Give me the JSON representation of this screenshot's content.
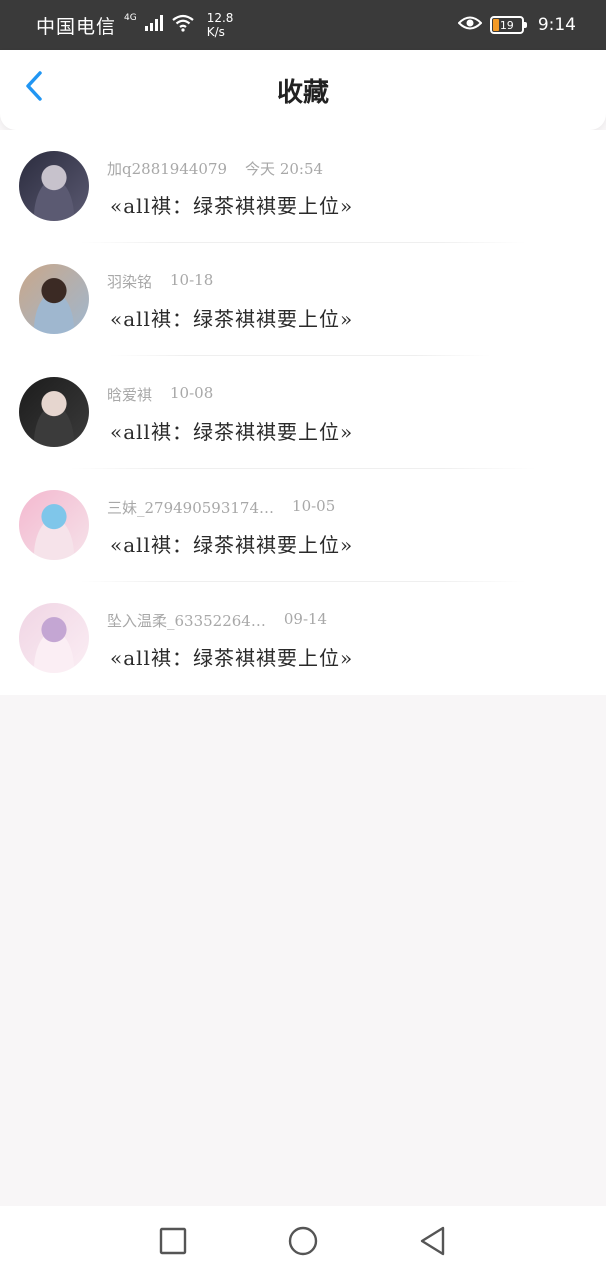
{
  "status_bar": {
    "carrier": "中国电信",
    "network": "4G",
    "speed_value": "12.8",
    "speed_unit": "K/s",
    "battery": "19",
    "time": "9:14"
  },
  "nav": {
    "title": "收藏",
    "back_icon": "chevron-left-icon"
  },
  "favorites": [
    {
      "username": "加q2881944079",
      "date": "今天 20:54",
      "title": "«all褀：绿茶褀褀要上位»",
      "avatar_colors": [
        "#2b2c3e",
        "#c7c2cc",
        "#5b5a72"
      ]
    },
    {
      "username": "羽染铭",
      "date": "10-18",
      "title": "«all褀：绿茶褀褀要上位»",
      "avatar_colors": [
        "#c9a78a",
        "#3b2a24",
        "#9fb7cf"
      ]
    },
    {
      "username": "晗爱褀",
      "date": "10-08",
      "title": "«all褀：绿茶褀褀要上位»",
      "avatar_colors": [
        "#1c1c1c",
        "#e6d6cf",
        "#3b3b3b"
      ]
    },
    {
      "username": "三妹_279490593174…",
      "date": "10-05",
      "title": "«all褀：绿茶褀褀要上位»",
      "avatar_colors": [
        "#f3b8cf",
        "#7fc6ea",
        "#f6e3ea"
      ]
    },
    {
      "username": "坠入温柔_63352264…",
      "date": "09-14",
      "title": "«all褀：绿茶褀褀要上位»",
      "avatar_colors": [
        "#f0d5e4",
        "#c4a6d3",
        "#fbeef4"
      ]
    }
  ],
  "system_nav": {
    "recent_icon": "square-icon",
    "home_icon": "circle-icon",
    "back_icon": "triangle-back-icon"
  },
  "colors": {
    "accent": "#2196f3",
    "status_bar_bg": "#3a3a3a",
    "page_bg": "#f8f6f7",
    "battery": "#f39a26"
  }
}
